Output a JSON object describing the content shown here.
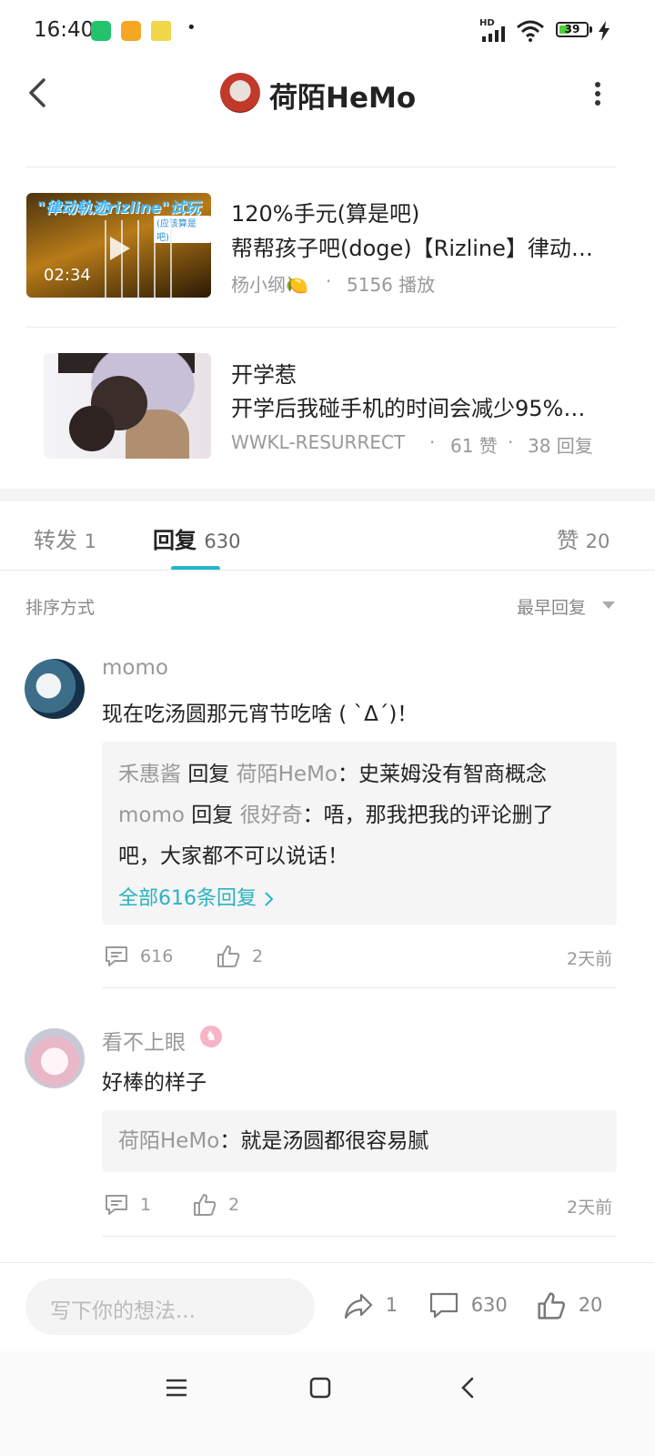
{
  "status_bar": {
    "time": "16:40",
    "network": "HD",
    "battery": "39",
    "battery_percent": 39,
    "dot": "•",
    "icons": [
      "app-shield-icon",
      "app-folder-icon",
      "emoji-100-icon",
      "signal-icon",
      "wifi-icon",
      "battery-icon",
      "charging-bolt-icon"
    ],
    "app_icon_colors": [
      "#22c36a",
      "#f5a623",
      "#f2d64b"
    ]
  },
  "header": {
    "title": "荷陌HeMo",
    "back_icon": "chevron-left-icon",
    "more_icon": "more-vertical-icon"
  },
  "related": [
    {
      "title": "120%手元(算是吧)",
      "subtitle": "帮帮孩子吧(doge)【Rizline】律动…",
      "author": "杨小纲🍋",
      "sep": "·",
      "plays": "5156 播放",
      "duration": "02:34",
      "thumb_banner": "\"律动轨迹rizline\"试玩",
      "thumb_tag": "(应该算是吧)"
    },
    {
      "title": "开学惹",
      "subtitle": "开学后我碰手机的时间会减少95%…",
      "author": "WWKL-RESURRECT",
      "sep": "·",
      "likes": "61 赞",
      "sep2": "·",
      "replies": "38 回复"
    }
  ],
  "tabs": [
    {
      "label": "转发",
      "count": "1"
    },
    {
      "label": "回复",
      "count": "630"
    },
    {
      "label": "赞",
      "count": "20"
    }
  ],
  "sort": {
    "label": "排序方式",
    "value": "最早回复"
  },
  "comments": [
    {
      "user": "momo",
      "text": "现在吃汤圆那元宵节吃啥 ( `Δ´)！",
      "replies": [
        {
          "from": "禾惠酱",
          "verb": "回复",
          "to": "荷陌HeMo",
          "text": "：史莱姆没有智商概念"
        },
        {
          "from": "momo",
          "verb": "回复",
          "to": "很好奇",
          "text": "：唔，那我把我的评论删了",
          "text2": "吧，大家都不可以说话！"
        }
      ],
      "all_replies": "全部616条回复",
      "reply_count": "616",
      "like_count": "2",
      "time": "2天前"
    },
    {
      "user": "看不上眼",
      "badge": "♞",
      "text": "好棒的样子",
      "replies": [
        {
          "from": "荷陌HeMo",
          "text": "：就是汤圆都很容易腻"
        }
      ],
      "reply_count": "1",
      "like_count": "2",
      "time": "2天前"
    }
  ],
  "bottom_bar": {
    "placeholder": "写下你的想法...",
    "share_count": "1",
    "comment_count": "630",
    "like_count": "20"
  },
  "accent_color": "#23b7c8"
}
